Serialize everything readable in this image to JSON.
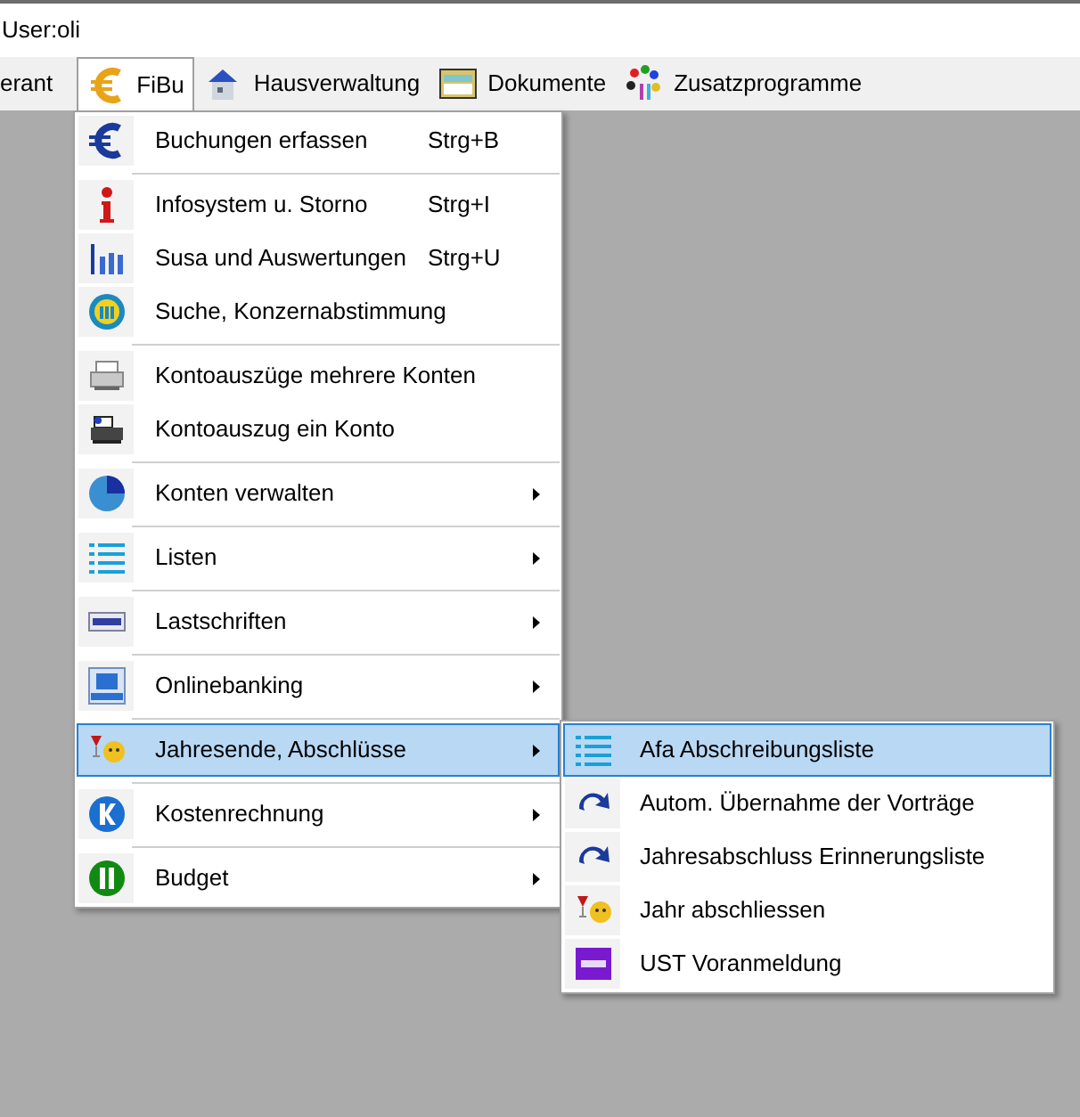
{
  "user_label": "User:oli",
  "menubar": [
    {
      "label": "erant",
      "selected": false
    },
    {
      "label": "FiBu",
      "selected": true
    },
    {
      "label": "Hausverwaltung",
      "selected": false
    },
    {
      "label": "Dokumente",
      "selected": false
    },
    {
      "label": "Zusatzprogramme",
      "selected": false
    }
  ],
  "menu": [
    {
      "kind": "item",
      "label": "Buchungen erfassen",
      "shortcut": "Strg+B",
      "submenu": false,
      "selected": false
    },
    {
      "kind": "separator"
    },
    {
      "kind": "item",
      "label": "Infosystem u. Storno",
      "shortcut": "Strg+I",
      "submenu": false,
      "selected": false
    },
    {
      "kind": "item",
      "label": "Susa und Auswertungen",
      "shortcut": "Strg+U",
      "submenu": false,
      "selected": false
    },
    {
      "kind": "item",
      "label": "Suche, Konzernabstimmung",
      "submenu": false,
      "selected": false
    },
    {
      "kind": "separator"
    },
    {
      "kind": "item",
      "label": "Kontoauszüge mehrere Konten",
      "submenu": false,
      "selected": false
    },
    {
      "kind": "item",
      "label": "Kontoauszug ein Konto",
      "submenu": false,
      "selected": false
    },
    {
      "kind": "separator"
    },
    {
      "kind": "item",
      "label": "Konten verwalten",
      "submenu": true,
      "selected": false
    },
    {
      "kind": "separator"
    },
    {
      "kind": "item",
      "label": "Listen",
      "submenu": true,
      "selected": false
    },
    {
      "kind": "separator"
    },
    {
      "kind": "item",
      "label": "Lastschriften",
      "submenu": true,
      "selected": false
    },
    {
      "kind": "separator"
    },
    {
      "kind": "item",
      "label": "Onlinebanking",
      "submenu": true,
      "selected": false
    },
    {
      "kind": "separator"
    },
    {
      "kind": "item",
      "label": "Jahresende, Abschlüsse",
      "submenu": true,
      "selected": true
    },
    {
      "kind": "separator"
    },
    {
      "kind": "item",
      "label": "Kostenrechnung",
      "submenu": true,
      "selected": false
    },
    {
      "kind": "separator"
    },
    {
      "kind": "item",
      "label": "Budget",
      "submenu": true,
      "selected": false
    }
  ],
  "submenu": [
    {
      "label": "Afa Abschreibungsliste",
      "selected": true
    },
    {
      "label": "Autom. Übernahme der Vorträge",
      "selected": false
    },
    {
      "label": "Jahresabschluss Erinnerungsliste",
      "selected": false
    },
    {
      "label": "Jahr abschliessen",
      "selected": false
    },
    {
      "label": "UST Voranmeldung",
      "selected": false
    }
  ]
}
